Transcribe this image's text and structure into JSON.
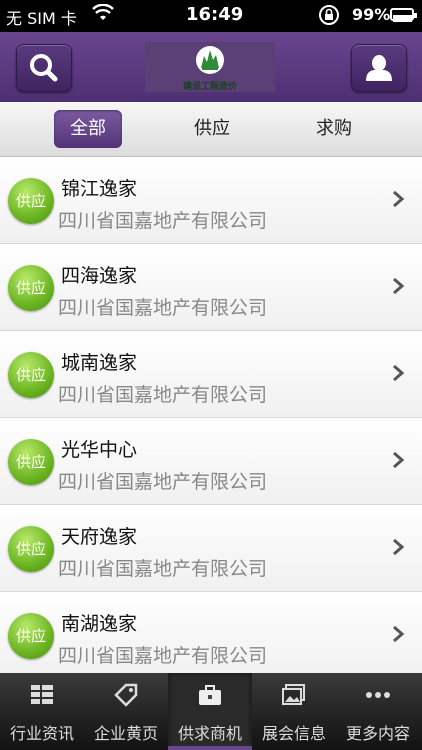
{
  "status_bar": {
    "carrier": "无 SIM 卡",
    "time": "16:49",
    "battery": "99%"
  },
  "header": {
    "logo_text": "建设工程造价"
  },
  "filter_tabs": [
    {
      "label": "全部",
      "selected": true
    },
    {
      "label": "供应",
      "selected": false
    },
    {
      "label": "求购",
      "selected": false
    }
  ],
  "listings": [
    {
      "badge": "供应",
      "title": "锦江逸家",
      "company": "四川省国嘉地产有限公司"
    },
    {
      "badge": "供应",
      "title": "四海逸家",
      "company": "四川省国嘉地产有限公司"
    },
    {
      "badge": "供应",
      "title": "城南逸家",
      "company": "四川省国嘉地产有限公司"
    },
    {
      "badge": "供应",
      "title": "光华中心",
      "company": "四川省国嘉地产有限公司"
    },
    {
      "badge": "供应",
      "title": "天府逸家",
      "company": "四川省国嘉地产有限公司"
    },
    {
      "badge": "供应",
      "title": "南湖逸家",
      "company": "四川省国嘉地产有限公司"
    }
  ],
  "bottom_tabs": [
    {
      "label": "行业资讯",
      "icon": "list-icon"
    },
    {
      "label": "企业黄页",
      "icon": "tag-icon"
    },
    {
      "label": "供求商机",
      "icon": "briefcase-icon",
      "active": true
    },
    {
      "label": "展会信息",
      "icon": "pictures-icon"
    },
    {
      "label": "更多内容",
      "icon": "more-icon"
    }
  ],
  "colors": {
    "header": "#5b3a80",
    "badge": "#6bb521",
    "tabbar": "#1f1f1f"
  }
}
